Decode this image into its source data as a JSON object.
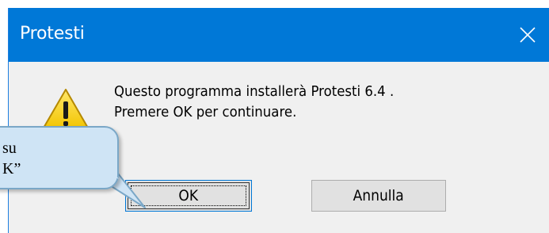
{
  "window": {
    "title": "Protesti",
    "close_icon": "close-icon"
  },
  "dialog": {
    "icon": "warning-icon",
    "message_line1": "Questo programma installerà Protesti  6.4 .",
    "message_line2": "Premere OK per continuare.",
    "ok_label": "OK",
    "cancel_label": "Annulla"
  },
  "callout": {
    "line1": "su",
    "line2": "K”"
  },
  "colors": {
    "titlebar": "#0078d7",
    "dialog_bg": "#f0f0f0",
    "button_bg": "#e1e1e1",
    "callout_fill": "#cfe4f5",
    "callout_border": "#7aa7c7"
  }
}
